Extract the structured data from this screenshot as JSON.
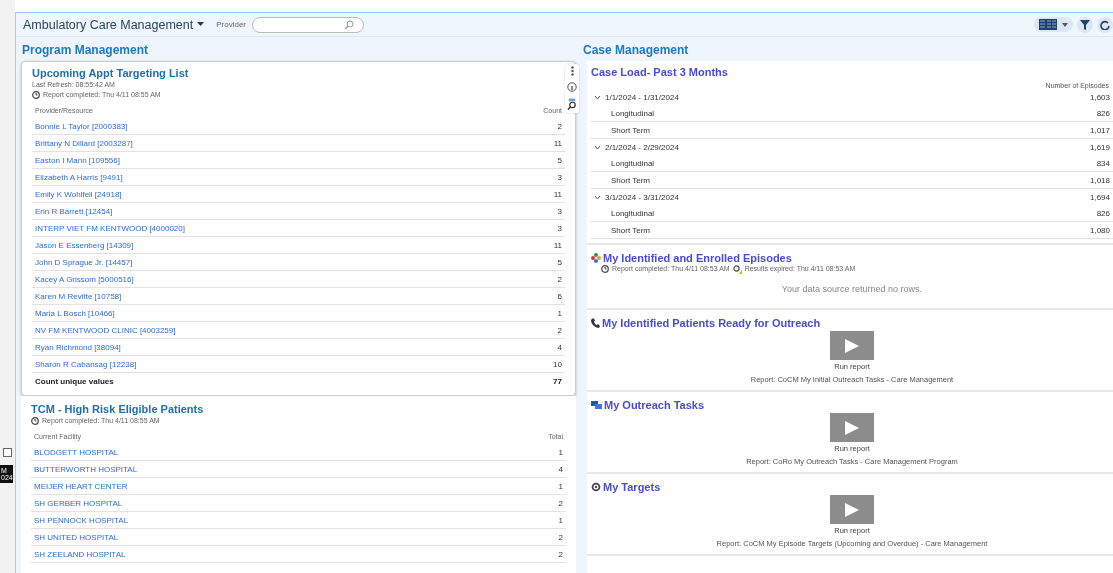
{
  "app": {
    "title": "Ambulatory Care Management",
    "provider_label": "Provider"
  },
  "side": {
    "texts": [
      "M",
      "024"
    ]
  },
  "left": {
    "heading": "Program Management",
    "appt_list": {
      "title": "Upcoming Appt Targeting List",
      "last_refresh": "Last Refresh: 08:55:42 AM",
      "completed": "Report completed: Thu 4/11 08:55 AM",
      "columns": [
        "Provider/Resource",
        "Count"
      ],
      "rows": [
        {
          "name": "Bonnie L Taylor [2000383]",
          "count": "2"
        },
        {
          "name": "Brittany N Dillard [2003287]",
          "count": "11"
        },
        {
          "name": "Easton I Mann [109556]",
          "count": "5"
        },
        {
          "name": "Elizabeth A Harris [9491]",
          "count": "3"
        },
        {
          "name": "Emily K Wohlfeil [24918]",
          "count": "11"
        },
        {
          "name": "Erin R Barrett [12454]",
          "count": "3"
        },
        {
          "name": "INTERP VIET FM KENTWOOD [4000020]",
          "count": "3"
        },
        {
          "name": "Jason E Essenberg [14309]",
          "count": "11"
        },
        {
          "name": "John D Sprague Jr. [14457]",
          "count": "5"
        },
        {
          "name": "Kacey A Grissom [5000516]",
          "count": "2"
        },
        {
          "name": "Karen M Revitte [10758]",
          "count": "6"
        },
        {
          "name": "Maria L Bosch [10466]",
          "count": "1"
        },
        {
          "name": "NV FM KENTWOOD CLINIC [4003259]",
          "count": "2"
        },
        {
          "name": "Ryan Richmond [38094]",
          "count": "4"
        },
        {
          "name": "Sharon R Cabansag [12238]",
          "count": "10"
        }
      ],
      "total": {
        "label": "Count unique values",
        "value": "77"
      }
    },
    "tcm": {
      "title": "TCM - High Risk Eligible Patients",
      "completed": "Report completed: Thu 4/11 08:55 AM",
      "columns": [
        "Current Facility",
        "Total"
      ],
      "rows": [
        {
          "name": "BLODGETT HOSPITAL",
          "count": "1"
        },
        {
          "name": "BUTTERWORTH HOSPITAL",
          "count": "4"
        },
        {
          "name": "MEIJER HEART CENTER",
          "count": "1"
        },
        {
          "name": "SH GERBER HOSPITAL",
          "count": "2"
        },
        {
          "name": "SH PENNOCK HOSPITAL",
          "count": "1"
        },
        {
          "name": "SH UNITED HOSPITAL",
          "count": "2"
        },
        {
          "name": "SH ZEELAND HOSPITAL",
          "count": "2"
        }
      ]
    }
  },
  "right": {
    "heading": "Case Management",
    "case_load": {
      "title": "Case Load- Past 3 Months",
      "column": "Number of Episodes",
      "groups": [
        {
          "period": "1/1/2024 - 1/31/2024",
          "value": "1,603",
          "expanded": true,
          "children": [
            {
              "label": "Longitudinal",
              "value": "826"
            },
            {
              "label": "Short Term",
              "value": "1,017"
            }
          ]
        },
        {
          "period": "2/1/2024 - 2/29/2024",
          "value": "1,619",
          "expanded": true,
          "children": [
            {
              "label": "Longitudinal",
              "value": "834"
            },
            {
              "label": "Short Term",
              "value": "1,018"
            }
          ]
        },
        {
          "period": "3/1/2024 - 3/31/2024",
          "value": "1,694",
          "expanded": true,
          "children": [
            {
              "label": "Longitudinal",
              "value": "826"
            },
            {
              "label": "Short Term",
              "value": "1,080"
            }
          ]
        }
      ]
    },
    "reports": [
      {
        "kind": "empty",
        "title": "My Identified and Enrolled Episodes",
        "completed": "Report completed: Thu 4/11 08:53 AM",
        "expired": "Results expired: Thu 4/11 08:53 AM",
        "message": "Your data source returned no rows."
      },
      {
        "kind": "run",
        "title": "My Identified Patients Ready for Outreach",
        "run_label": "Run report",
        "report": "Report: CoCM My Initial Outreach Tasks - Care Management"
      },
      {
        "kind": "run",
        "title": "My Outreach Tasks",
        "run_label": "Run report",
        "report": "Report: CoRo My Outreach Tasks - Care Management Program"
      },
      {
        "kind": "run",
        "title": "My Targets",
        "run_label": "Run report",
        "report": "Report: CoCM My Episode Targets (Upcoming and Overdue) - Care Management"
      }
    ]
  }
}
